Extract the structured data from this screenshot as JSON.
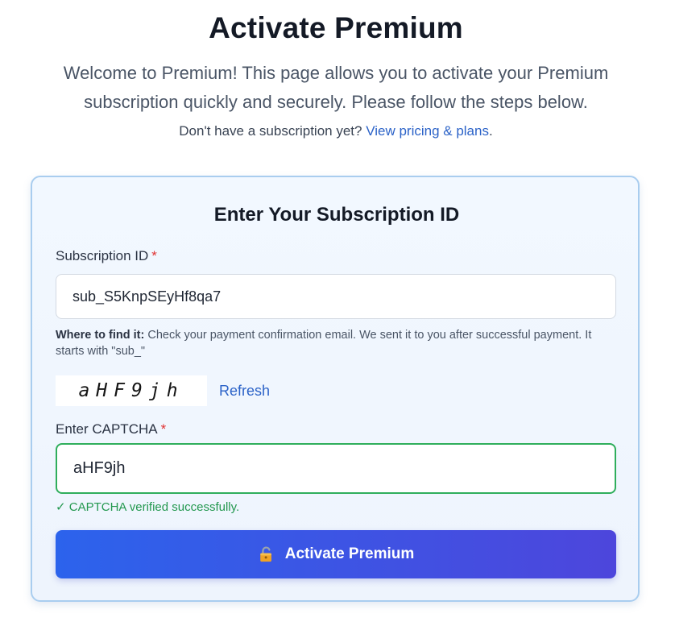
{
  "header": {
    "title": "Activate Premium",
    "intro": "Welcome to Premium! This page allows you to activate your Premium subscription quickly and securely. Please follow the steps below.",
    "pricing_prompt": "Don't have a subscription yet? ",
    "pricing_link": "View pricing & plans",
    "pricing_suffix": "."
  },
  "form": {
    "title": "Enter Your Subscription ID",
    "subscription_label": "Subscription ID",
    "required_mark": "*",
    "subscription_value": "sub_S5KnpSEyHf8qa7",
    "hint_bold": "Where to find it:",
    "hint_text": " Check your payment confirmation email. We sent it to you after successful payment. It starts with \"sub_\"",
    "captcha_image_text": "aHF9jh",
    "refresh_label": "Refresh",
    "captcha_label": "Enter CAPTCHA",
    "captcha_value": "aHF9jh",
    "verified_text": "✓ CAPTCHA verified successfully.",
    "submit_label": "Activate Premium",
    "submit_icon": "unlocked-lock-icon"
  },
  "colors": {
    "accent_blue": "#2c63c8",
    "success_green": "#2fae5c",
    "required_red": "#e03131",
    "button_gradient_start": "#2c63ec",
    "button_gradient_end": "#4d46dc"
  }
}
